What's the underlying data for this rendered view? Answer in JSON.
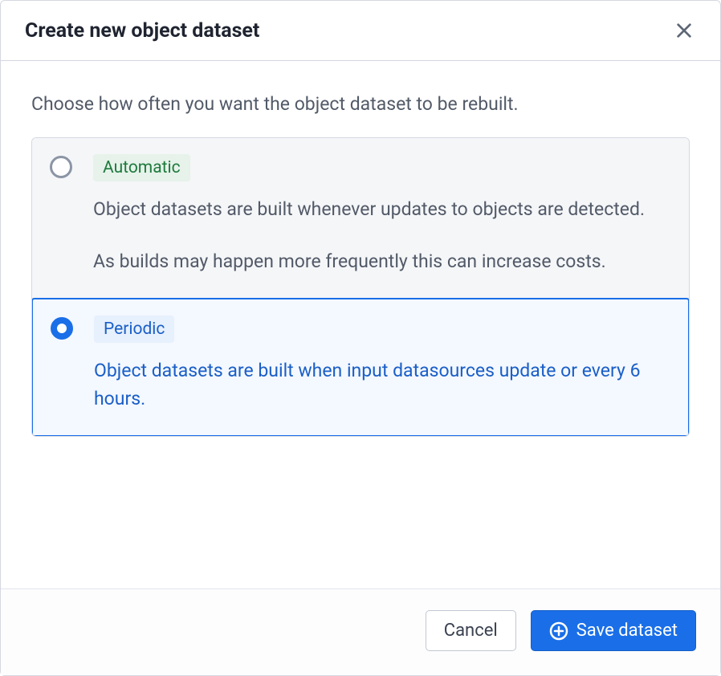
{
  "dialog": {
    "title": "Create new object dataset"
  },
  "body": {
    "intro": "Choose how often you want the object dataset to be rebuilt."
  },
  "options": {
    "automatic": {
      "badge": "Automatic",
      "desc1": "Object datasets are built whenever updates to objects are detected.",
      "desc2": "As builds may happen more frequently this can increase costs.",
      "selected": false
    },
    "periodic": {
      "badge": "Periodic",
      "desc": "Object datasets are built when input datasources update or every 6 hours.",
      "selected": true
    }
  },
  "footer": {
    "cancel": "Cancel",
    "save": "Save dataset"
  }
}
